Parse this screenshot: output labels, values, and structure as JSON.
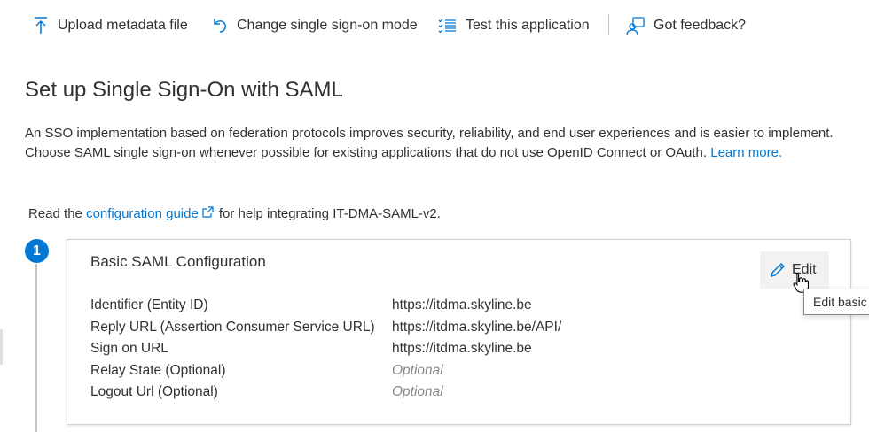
{
  "toolbar": {
    "upload_label": "Upload metadata file",
    "change_sso_label": "Change single sign-on mode",
    "test_label": "Test this application",
    "feedback_label": "Got feedback?"
  },
  "page": {
    "title": "Set up Single Sign-On with SAML",
    "description_text": "An SSO implementation based on federation protocols improves security, reliability, and end user experiences and is easier to implement. Choose SAML single sign-on whenever possible for existing applications that do not use OpenID Connect or OAuth.",
    "learn_more_link": "Learn more.",
    "guide_prefix": "Read the",
    "guide_link": "configuration guide",
    "guide_suffix": "for help integrating IT-DMA-SAML-v2."
  },
  "step1": {
    "number": "1",
    "card_title": "Basic SAML Configuration",
    "edit_label": "Edit",
    "tooltip": "Edit basic",
    "rows": [
      {
        "label": "Identifier (Entity ID)",
        "value": "https://itdma.skyline.be"
      },
      {
        "label": "Reply URL (Assertion Consumer Service URL)",
        "value": "https://itdma.skyline.be/API/"
      },
      {
        "label": "Sign on URL",
        "value": "https://itdma.skyline.be"
      },
      {
        "label": "Relay State (Optional)",
        "value": "Optional"
      },
      {
        "label": "Logout Url (Optional)",
        "value": "Optional"
      }
    ]
  },
  "icons": [
    "upload-icon",
    "undo-icon",
    "checklist-icon",
    "feedback-icon",
    "external-link-icon",
    "pencil-icon",
    "hand-cursor-icon"
  ],
  "colors": {
    "accent": "#0078d4",
    "text": "#323130",
    "muted": "#8a8886"
  }
}
